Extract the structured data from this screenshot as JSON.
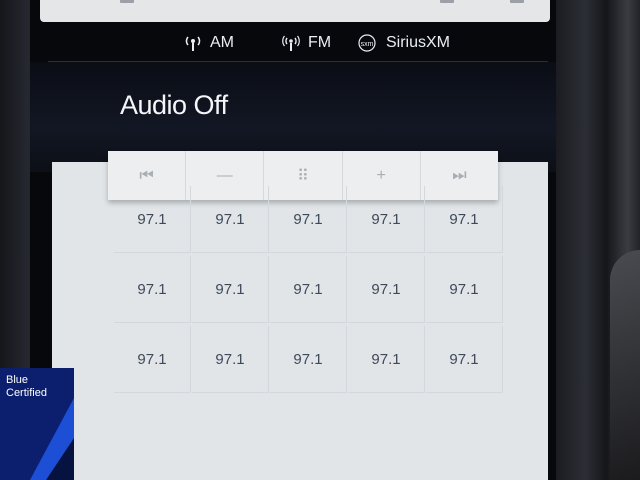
{
  "sources": {
    "am_label": "AM",
    "fm_label": "FM",
    "sxm_label": "SiriusXM",
    "sxm_logo_text": "sxm"
  },
  "header": {
    "title": "Audio Off"
  },
  "transport": {
    "icons": [
      "skip-back-icon",
      "minus-icon",
      "keypad-icon",
      "plus-icon",
      "skip-forward-icon"
    ],
    "glyphs": [
      "⏮",
      "—",
      "⠿",
      "+",
      "⏭"
    ]
  },
  "presets": [
    [
      "97.1",
      "97.1",
      "97.1",
      "97.1",
      "97.1"
    ],
    [
      "97.1",
      "97.1",
      "97.1",
      "97.1",
      "97.1"
    ],
    [
      "97.1",
      "97.1",
      "97.1",
      "97.1",
      "97.1"
    ]
  ],
  "badge": {
    "line1": "Blue",
    "line2": "Certified"
  },
  "colors": {
    "panel": "#e1e5e8",
    "preset_text": "#3e4a5a",
    "badge_blue": "#0b1f6e",
    "badge_accent": "#1c4fd6"
  }
}
